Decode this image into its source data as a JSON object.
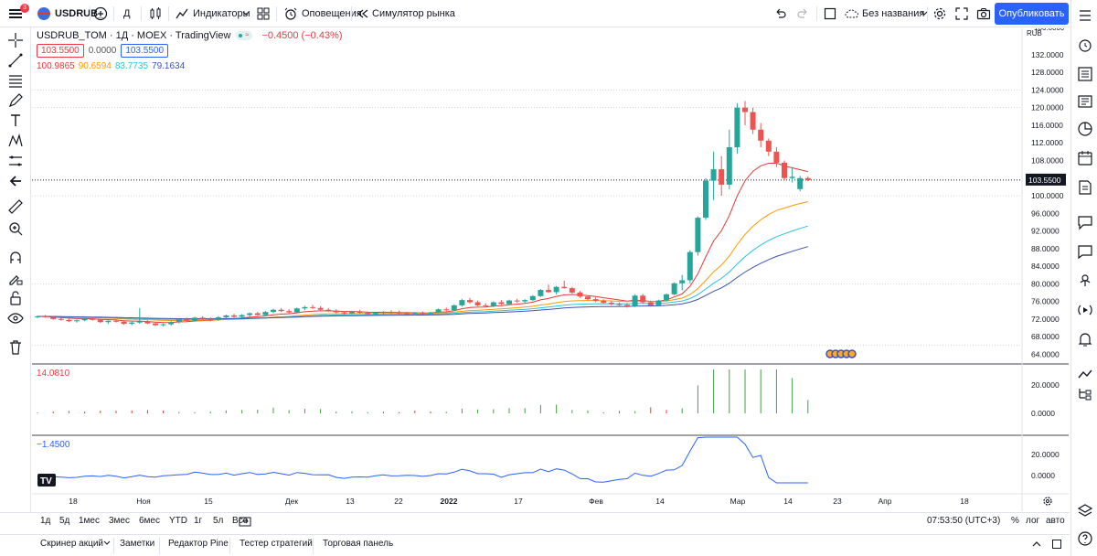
{
  "toolbar": {
    "symbol": "USDRUB_",
    "interval": "Д",
    "indicators": "Индикаторы",
    "alerts": "Оповещения",
    "replay": "Симулятор рынка",
    "layout_name": "Без названия",
    "publish": "Опубликовать",
    "menu_badge": "3"
  },
  "legend": {
    "title": "USDRUB_TOM · 1Д · MOEX · TradingView",
    "change": "−0.4500 (−0.43%)",
    "bid": "103.5500",
    "spread": "0.0000",
    "ask": "103.5500",
    "ma_values": [
      {
        "value": "100.9865",
        "color": "#e53935"
      },
      {
        "value": "90.6594",
        "color": "#ff9800"
      },
      {
        "value": "83.7735",
        "color": "#26c6da"
      },
      {
        "value": "79.1634",
        "color": "#3f51b5"
      }
    ]
  },
  "price_axis": {
    "currency": "RUB",
    "top_label": "136.0000",
    "labels": [
      "132.0000",
      "128.0000",
      "124.0000",
      "120.0000",
      "116.0000",
      "112.0000",
      "108.0000",
      "104.0000",
      "100.0000",
      "96.0000",
      "92.0000",
      "88.0000",
      "84.0000",
      "80.0000",
      "76.0000",
      "72.0000",
      "68.0000",
      "64.0000"
    ],
    "last_price": "103.5500"
  },
  "pane2": {
    "value": "14.0810",
    "axis": [
      "20.0000",
      "0.0000"
    ]
  },
  "pane3": {
    "value": "−1.4500",
    "axis": [
      "20.0000",
      "0.0000"
    ]
  },
  "time_axis": [
    "18",
    "Ноя",
    "15",
    "Дек",
    "13",
    "22",
    "2022",
    "17",
    "Фев",
    "14",
    "Мар",
    "14",
    "23",
    "Апр",
    "18"
  ],
  "timeframes": [
    "1д",
    "5д",
    "1мес",
    "3мес",
    "6мес",
    "YTD",
    "1г",
    "5л",
    "Все"
  ],
  "clock": "07:53:50 (UTC+3)",
  "scale_opts": [
    "%",
    "лог",
    "авто"
  ],
  "bottom_tabs": [
    "Скринер акций",
    "Заметки",
    "Редактор Pine",
    "Тестер стратегий",
    "Торговая панель"
  ],
  "chart_data": {
    "type": "candlestick",
    "ylim": [
      62,
      138
    ],
    "candles": [
      [
        72.5,
        72.8,
        72.2,
        72.6
      ],
      [
        72.6,
        72.9,
        72.3,
        72.4
      ],
      [
        72.4,
        72.7,
        71.8,
        72.0
      ],
      [
        72.0,
        72.3,
        71.6,
        71.8
      ],
      [
        71.8,
        72.1,
        71.3,
        71.5
      ],
      [
        71.5,
        71.9,
        71.2,
        71.7
      ],
      [
        71.7,
        72.2,
        71.5,
        72.1
      ],
      [
        72.1,
        72.4,
        71.6,
        71.8
      ],
      [
        71.8,
        72.0,
        71.1,
        71.3
      ],
      [
        71.3,
        71.7,
        70.9,
        71.6
      ],
      [
        71.6,
        72.0,
        71.2,
        71.4
      ],
      [
        71.4,
        71.6,
        70.7,
        70.9
      ],
      [
        70.9,
        71.4,
        70.6,
        71.2
      ],
      [
        71.2,
        74.5,
        70.9,
        71.5
      ],
      [
        71.5,
        71.8,
        70.8,
        71.0
      ],
      [
        71.0,
        71.3,
        70.4,
        70.6
      ],
      [
        70.6,
        71.0,
        70.3,
        70.8
      ],
      [
        70.8,
        71.6,
        70.5,
        71.3
      ],
      [
        71.3,
        72.1,
        71.0,
        71.9
      ],
      [
        71.9,
        72.3,
        71.4,
        71.6
      ],
      [
        71.6,
        72.5,
        71.4,
        72.3
      ],
      [
        72.3,
        72.6,
        71.8,
        72.0
      ],
      [
        72.0,
        72.4,
        71.5,
        71.8
      ],
      [
        71.8,
        72.6,
        71.6,
        72.4
      ],
      [
        72.4,
        73.0,
        72.1,
        72.8
      ],
      [
        72.8,
        73.2,
        72.3,
        72.5
      ],
      [
        72.5,
        73.1,
        72.2,
        72.9
      ],
      [
        72.9,
        73.5,
        72.6,
        73.3
      ],
      [
        73.3,
        73.6,
        72.7,
        72.9
      ],
      [
        72.9,
        73.8,
        72.7,
        73.6
      ],
      [
        73.6,
        74.3,
        73.3,
        74.1
      ],
      [
        74.1,
        74.5,
        73.6,
        73.8
      ],
      [
        73.8,
        74.2,
        73.2,
        73.5
      ],
      [
        73.5,
        74.6,
        73.4,
        74.4
      ],
      [
        74.4,
        75.0,
        74.0,
        74.7
      ],
      [
        74.7,
        75.2,
        74.3,
        74.5
      ],
      [
        74.5,
        74.9,
        73.9,
        74.1
      ],
      [
        74.1,
        74.5,
        73.6,
        73.9
      ],
      [
        73.9,
        74.2,
        73.3,
        73.5
      ],
      [
        73.5,
        73.8,
        73.0,
        73.3
      ],
      [
        73.3,
        73.9,
        73.1,
        73.7
      ],
      [
        73.7,
        74.1,
        73.2,
        73.4
      ],
      [
        73.4,
        73.7,
        72.9,
        73.1
      ],
      [
        73.1,
        73.5,
        72.8,
        73.4
      ],
      [
        73.4,
        73.8,
        73.1,
        73.6
      ],
      [
        73.6,
        74.0,
        73.2,
        73.5
      ],
      [
        73.5,
        73.9,
        73.1,
        73.3
      ],
      [
        73.3,
        73.6,
        72.9,
        73.2
      ],
      [
        73.2,
        73.6,
        72.8,
        73.4
      ],
      [
        73.4,
        73.7,
        73.0,
        73.2
      ],
      [
        73.2,
        73.6,
        72.9,
        73.5
      ],
      [
        73.5,
        74.4,
        73.3,
        74.2
      ],
      [
        74.2,
        74.6,
        73.8,
        74.0
      ],
      [
        74.0,
        75.3,
        73.9,
        75.1
      ],
      [
        75.1,
        76.6,
        74.8,
        76.3
      ],
      [
        76.3,
        76.8,
        75.5,
        75.8
      ],
      [
        75.8,
        76.2,
        74.9,
        75.1
      ],
      [
        75.1,
        75.6,
        74.6,
        74.9
      ],
      [
        74.9,
        76.0,
        74.7,
        75.8
      ],
      [
        75.8,
        76.3,
        75.2,
        75.4
      ],
      [
        75.4,
        76.4,
        75.2,
        76.2
      ],
      [
        76.2,
        76.6,
        75.7,
        76.0
      ],
      [
        76.0,
        76.5,
        75.6,
        76.3
      ],
      [
        76.3,
        77.4,
        76.1,
        77.2
      ],
      [
        77.2,
        78.8,
        77.0,
        78.6
      ],
      [
        78.6,
        79.8,
        77.9,
        78.1
      ],
      [
        78.1,
        79.5,
        77.6,
        79.3
      ],
      [
        79.3,
        80.7,
        78.9,
        79.0
      ],
      [
        79.0,
        79.3,
        77.8,
        78.0
      ],
      [
        78.0,
        78.4,
        76.8,
        77.1
      ],
      [
        77.1,
        77.4,
        76.2,
        76.5
      ],
      [
        76.5,
        76.9,
        75.8,
        76.1
      ],
      [
        76.1,
        76.5,
        75.4,
        75.7
      ],
      [
        75.7,
        76.0,
        75.1,
        75.4
      ],
      [
        75.4,
        75.8,
        74.9,
        75.2
      ],
      [
        75.2,
        75.6,
        74.6,
        74.9
      ],
      [
        74.9,
        77.6,
        74.7,
        77.3
      ],
      [
        77.3,
        77.7,
        75.5,
        75.8
      ],
      [
        75.8,
        76.2,
        74.8,
        75.1
      ],
      [
        75.1,
        76.4,
        74.9,
        76.2
      ],
      [
        76.2,
        77.8,
        76.0,
        77.6
      ],
      [
        77.6,
        80.3,
        77.4,
        80.1
      ],
      [
        80.1,
        82.0,
        78.5,
        80.8
      ],
      [
        80.8,
        87.6,
        80.1,
        87.2
      ],
      [
        87.2,
        95.3,
        86.4,
        95.0
      ],
      [
        95.0,
        104.0,
        94.5,
        103.4
      ],
      [
        103.4,
        110.0,
        99.0,
        106.0
      ],
      [
        106.0,
        109.0,
        100.0,
        102.5
      ],
      [
        102.5,
        115.0,
        101.5,
        111.0
      ],
      [
        111.0,
        121.0,
        109.5,
        120.0
      ],
      [
        120.0,
        121.5,
        116.0,
        119.0
      ],
      [
        119.0,
        120.0,
        114.0,
        115.0
      ],
      [
        115.0,
        116.5,
        111.0,
        112.5
      ],
      [
        112.5,
        113.0,
        109.0,
        110.0
      ],
      [
        110.0,
        111.0,
        106.5,
        107.5
      ],
      [
        107.5,
        108.0,
        103.5,
        104.0
      ],
      [
        104.0,
        106.5,
        103.0,
        104.3
      ],
      [
        101.5,
        104.5,
        101.0,
        104.0
      ],
      [
        104.0,
        104.4,
        103.3,
        103.55
      ]
    ]
  }
}
